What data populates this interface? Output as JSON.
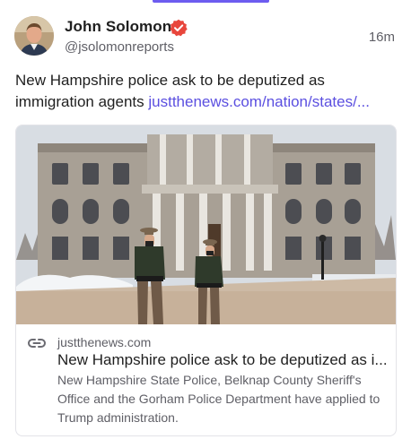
{
  "post": {
    "author_name": "John Solomon",
    "handle": "@jsolomonreports",
    "timestamp": "16m",
    "text": "New Hampshire police ask to be deputized as immigration agents",
    "link_text": "justthenews.com/nation/states/...",
    "verified": true
  },
  "link_card": {
    "domain": "justthenews.com",
    "title": "New Hampshire police ask to be deputized as i...",
    "description": "New Hampshire State Police, Belknap County Sheriff's Office and the Gorham Police Department have applied to Trump administration."
  },
  "colors": {
    "accent": "#6d5cf0",
    "link": "#5b4fe0",
    "verified_badge": "#e8463c",
    "secondary_text": "#5f5f66"
  },
  "icons": {
    "verified": "verified-badge-icon",
    "link": "link-icon"
  }
}
